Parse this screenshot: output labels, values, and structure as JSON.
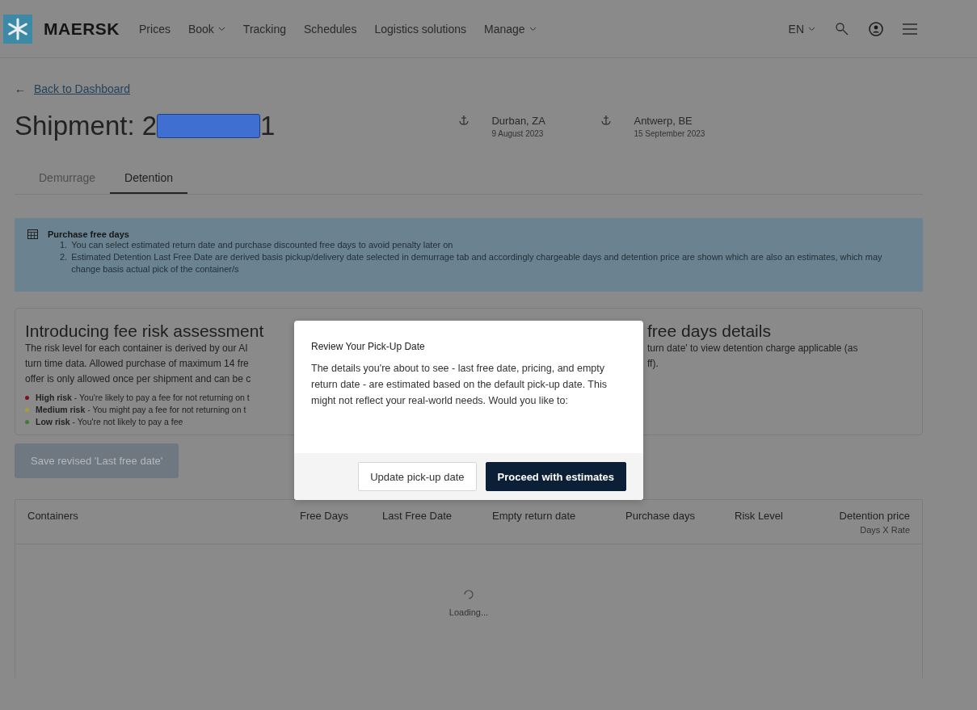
{
  "header": {
    "brand": "MAERSK",
    "nav": [
      {
        "label": "Prices",
        "has_menu": false
      },
      {
        "label": "Book",
        "has_menu": true
      },
      {
        "label": "Tracking",
        "has_menu": false
      },
      {
        "label": "Schedules",
        "has_menu": false
      },
      {
        "label": "Logistics solutions",
        "has_menu": false
      },
      {
        "label": "Manage",
        "has_menu": true
      }
    ],
    "language": "EN"
  },
  "back_arrow": "←",
  "back_link": "Back to Dashboard",
  "shipment": {
    "title_start": "Shipment: 2",
    "title_end": "1"
  },
  "route": [
    {
      "place": "Durban, ZA",
      "date": "9 August 2023"
    },
    {
      "place": "Antwerp, BE",
      "date": "15 September 2023"
    }
  ],
  "tabs": [
    {
      "label": "Demurrage",
      "selected": false
    },
    {
      "label": "Detention",
      "selected": true
    }
  ],
  "info": {
    "title": "Purchase free days",
    "items": [
      {
        "number": "1.",
        "text": "You can select estimated return date and purchase discounted free days to avoid penalty later on"
      },
      {
        "number": "2.",
        "text": "Estimated Detention Last Free Date are derived basis pickup/delivery date selected in demurrage tab and accordingly chargeable days and detention price are shown which are also an estimates, which may change basis actual pick of the container/s"
      }
    ]
  },
  "risk_card": {
    "title": "Introducing fee risk assessment",
    "lines": [
      "The risk level for each container is derived by our AI",
      "turn time data. Allowed purchase of maximum 14 fre",
      "offer is only allowed once per shipment and can be c"
    ],
    "levels": [
      {
        "text": "**High risk** - You're likely to pay a fee for not returning on t",
        "color": "#7a1020"
      },
      {
        "text": "**Medium risk** - You might pay a fee for not returning on t",
        "color": "#b09a32"
      },
      {
        "text": "**Low risk** - You're not likely to pay a fee",
        "color": "#3f7a3a"
      }
    ]
  },
  "details_card": {
    "title": "free days details",
    "lines": [
      "turn date' to view detention charge applicable (as",
      "ff)."
    ]
  },
  "save_button": {
    "label": "Save revised 'Last free date'",
    "disabled": true
  },
  "table": {
    "columns": [
      {
        "label": "Containers"
      },
      {
        "label": "Free Days"
      },
      {
        "label": "Last Free Date"
      },
      {
        "label": "Empty return date"
      },
      {
        "label": "Purchase days"
      },
      {
        "label": "Risk Level"
      },
      {
        "label": "Detention price",
        "sublabel": "Days X Rate"
      }
    ],
    "loading": "Loading..."
  },
  "modal": {
    "title": "Review Your Pick-Up Date",
    "body": "The details you're about to see - last free date, pricing, and empty return date - are estimated based on the default pick-up date. This might not reflect your real-world needs. Would you like to:",
    "buttons": [
      {
        "label": "Update pick-up date",
        "kind": "secondary"
      },
      {
        "label": "Proceed with estimates",
        "kind": "primary"
      }
    ]
  }
}
